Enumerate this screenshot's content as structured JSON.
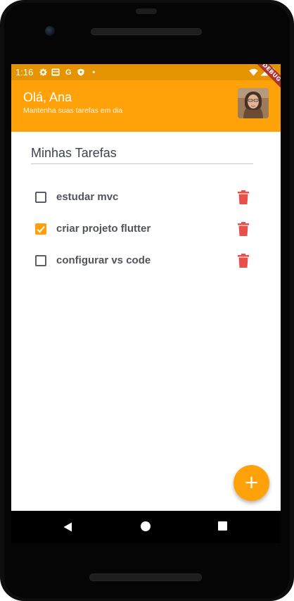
{
  "status_bar": {
    "time": "1:16",
    "icons": [
      "gear-icon",
      "image-icon",
      "google-icon",
      "shield-icon",
      "dot-icon"
    ],
    "google_glyph": "G",
    "dot_glyph": "•",
    "right_icons": [
      "wifi-icon",
      "signal-icon",
      "battery-icon"
    ],
    "color": "#e59400"
  },
  "app_bar": {
    "greeting": "Olá, Ana",
    "subtitle": "Mantenha suas tarefas em dia",
    "debug_banner": "DEBUG",
    "color": "#ffa20a"
  },
  "section": {
    "title": "Minhas Tarefas"
  },
  "tasks": [
    {
      "label": "estudar mvc",
      "checked": false
    },
    {
      "label": "criar projeto flutter",
      "checked": true
    },
    {
      "label": "configurar vs code",
      "checked": false
    }
  ],
  "fab": {
    "label": "+",
    "color": "#ffa20a"
  },
  "nav_bar": {
    "buttons": [
      "back-icon",
      "home-icon",
      "recents-icon"
    ]
  },
  "colors": {
    "accent": "#ffa20a",
    "delete": "#e8504a",
    "text": "#52545c"
  }
}
